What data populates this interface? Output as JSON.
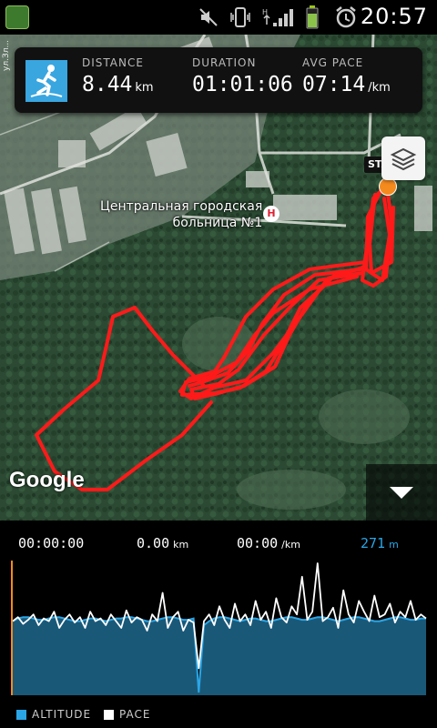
{
  "status_bar": {
    "time": "20:57",
    "icons": [
      "app-icon",
      "mute-icon",
      "vibrate-icon",
      "signal-icon",
      "battery-icon",
      "alarm-icon"
    ]
  },
  "stats": {
    "distance": {
      "label": "DISTANCE",
      "value": "8.44",
      "unit": "km"
    },
    "duration": {
      "label": "DURATION",
      "value": "01:01:06",
      "unit": ""
    },
    "avg_pace": {
      "label": "AVG PACE",
      "value": "07:14",
      "unit": "/km"
    }
  },
  "map": {
    "start_label": "STA",
    "poi_label_line1": "Центральная городская",
    "poi_label_line2": "больница №1",
    "poi_icon": "H",
    "street_label": "ул.Зл...",
    "attribution": "Google",
    "route_color": "#ff1a1a",
    "start_marker_color": "#f58a1f"
  },
  "readouts": {
    "time": "00:00:00",
    "distance": {
      "value": "0.00",
      "unit": "km"
    },
    "pace": {
      "value": "00:00",
      "unit": "/km"
    },
    "altitude": {
      "value": "271",
      "unit": "m"
    }
  },
  "legend": {
    "altitude": "ALTITUDE",
    "pace": "PACE",
    "altitude_color": "#2aa6e6",
    "pace_color": "#ffffff"
  },
  "chart_data": {
    "type": "area",
    "series": [
      {
        "name": "ALTITUDE",
        "values": [
          0.55,
          0.57,
          0.58,
          0.58,
          0.57,
          0.56,
          0.56,
          0.57,
          0.58,
          0.58,
          0.57,
          0.56,
          0.55,
          0.55,
          0.56,
          0.57,
          0.57,
          0.56,
          0.55,
          0.56,
          0.57,
          0.57,
          0.58,
          0.58,
          0.57,
          0.56,
          0.55,
          0.55,
          0.56,
          0.57,
          0.58,
          0.58,
          0.57,
          0.56,
          0.56,
          0.57,
          0.02,
          0.52,
          0.55,
          0.57,
          0.58,
          0.58,
          0.57,
          0.56,
          0.55,
          0.56,
          0.57,
          0.57,
          0.56,
          0.55,
          0.55,
          0.56,
          0.57,
          0.58,
          0.58,
          0.57,
          0.56,
          0.56,
          0.57,
          0.58,
          0.58,
          0.57,
          0.56,
          0.55,
          0.56,
          0.57,
          0.58,
          0.58,
          0.57,
          0.56,
          0.55,
          0.55,
          0.56,
          0.57,
          0.58,
          0.58,
          0.57,
          0.56,
          0.56,
          0.57,
          0.57
        ]
      },
      {
        "name": "PACE",
        "values": [
          0.55,
          0.58,
          0.53,
          0.56,
          0.6,
          0.52,
          0.57,
          0.55,
          0.62,
          0.5,
          0.56,
          0.6,
          0.54,
          0.58,
          0.5,
          0.62,
          0.55,
          0.57,
          0.52,
          0.6,
          0.55,
          0.5,
          0.63,
          0.54,
          0.58,
          0.56,
          0.48,
          0.6,
          0.55,
          0.76,
          0.5,
          0.58,
          0.62,
          0.48,
          0.56,
          0.54,
          0.2,
          0.55,
          0.6,
          0.52,
          0.66,
          0.56,
          0.5,
          0.68,
          0.55,
          0.6,
          0.52,
          0.7,
          0.56,
          0.62,
          0.5,
          0.72,
          0.58,
          0.54,
          0.66,
          0.6,
          0.88,
          0.56,
          0.62,
          0.98,
          0.55,
          0.58,
          0.65,
          0.5,
          0.78,
          0.6,
          0.54,
          0.7,
          0.62,
          0.55,
          0.74,
          0.58,
          0.6,
          0.68,
          0.54,
          0.62,
          0.58,
          0.7,
          0.56,
          0.6,
          0.57
        ]
      }
    ]
  }
}
